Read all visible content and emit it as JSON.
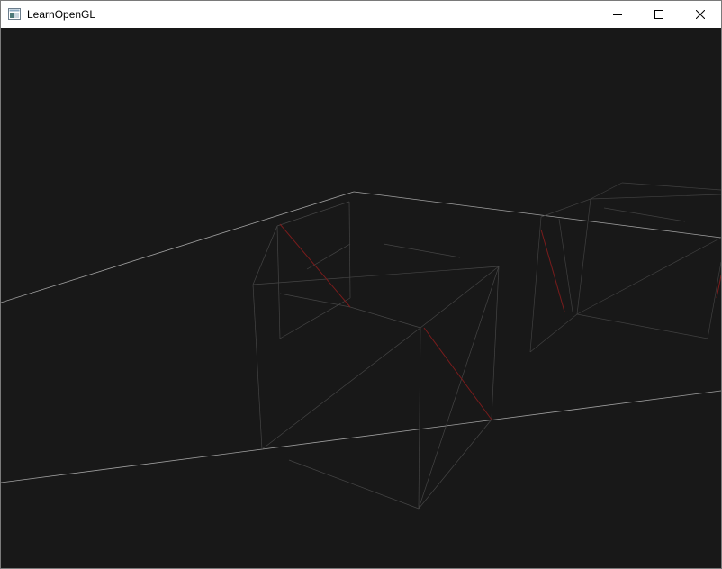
{
  "window": {
    "title": "LearnOpenGL",
    "icon": "application-window-icon",
    "controls": [
      "minimize-icon",
      "maximize-icon",
      "close-icon"
    ]
  },
  "viewport": {
    "content": "opengl-wireframe-render",
    "background_color": "#181818",
    "line_color_light": "#9a9a9a",
    "line_color_dim": "#444444",
    "line_color_red": "#7a1c1c"
  }
}
